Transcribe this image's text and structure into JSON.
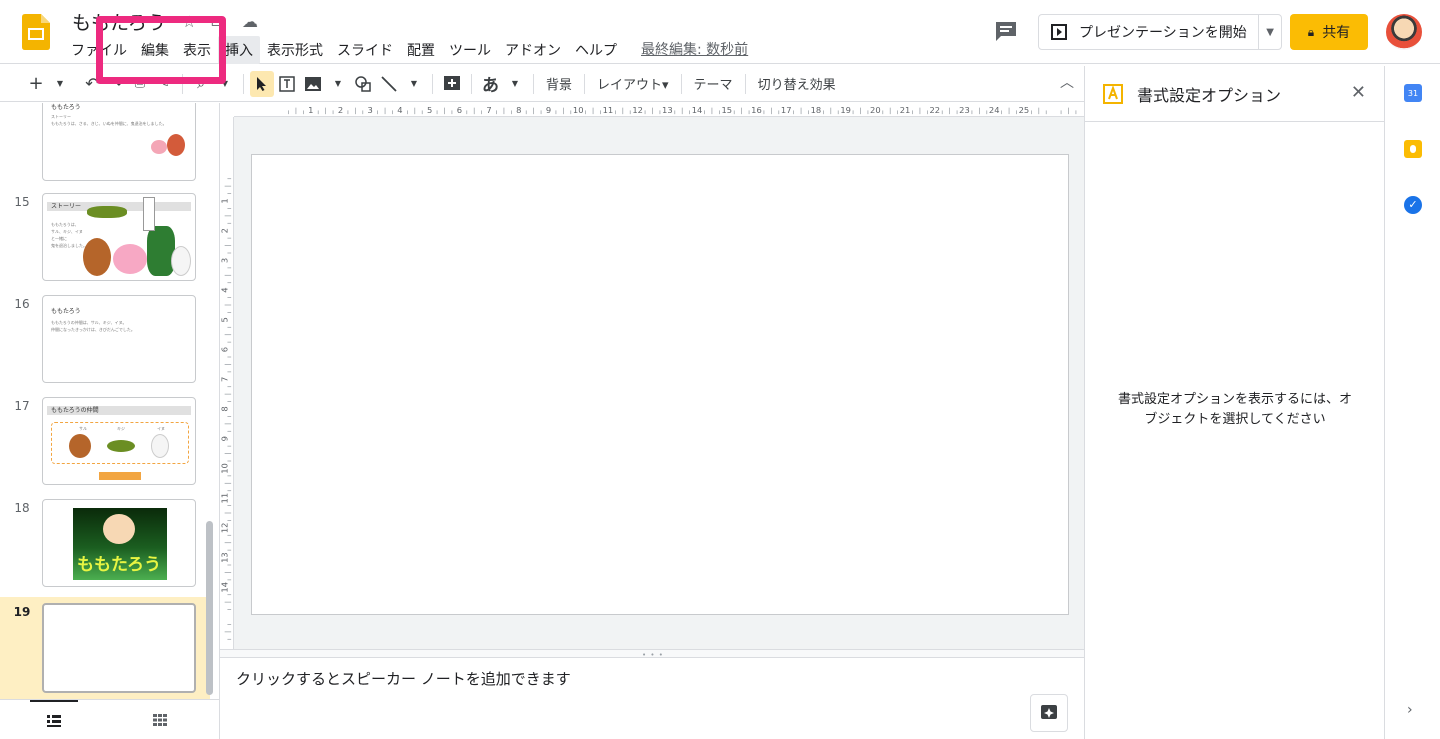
{
  "header": {
    "doc_title": "ももたろう",
    "menus": [
      "ファイル",
      "編集",
      "表示",
      "挿入",
      "表示形式",
      "スライド",
      "配置",
      "ツール",
      "アドオン",
      "ヘルプ"
    ],
    "last_edit": "最終編集: 数秒前",
    "present_label": "プレゼンテーションを開始",
    "share_label": "共有",
    "share_color": "#fbbc04"
  },
  "toolbar": {
    "background_label": "背景",
    "layout_label": "レイアウト▾",
    "theme_label": "テーマ",
    "transition_label": "切り替え効果",
    "font_glyph": "あ"
  },
  "filmstrip": {
    "slides": [
      {
        "num": "",
        "title": "ももたろう",
        "lines": [
          "ストーリー",
          "ももたろうは、さる、きじ、いぬを仲間に、鬼退治をしました。"
        ]
      },
      {
        "num": "15",
        "title": "ストーリー",
        "lines": [
          "ももたろうは、",
          "サル、キジ、イヌ",
          "と一緒に",
          "鬼を退治しました。"
        ]
      },
      {
        "num": "16",
        "title": "ももたろう",
        "lines": [
          "ももたろうの仲間は、サル、キジ、イヌ。",
          "仲間になったきっかけは、きびだんごでした。"
        ]
      },
      {
        "num": "17",
        "title": "ももたろうの仲間",
        "labels": [
          "サル",
          "キジ",
          "イヌ"
        ]
      },
      {
        "num": "18",
        "title": "ももたろう"
      },
      {
        "num": "19",
        "title": ""
      }
    ],
    "current_slide": "19"
  },
  "ruler": {
    "h_ticks": [
      "1",
      "2",
      "3",
      "4",
      "5",
      "6",
      "7",
      "8",
      "9",
      "10",
      "11",
      "12",
      "13",
      "14",
      "15",
      "16",
      "17",
      "18",
      "19",
      "20",
      "21",
      "22",
      "23",
      "24",
      "25"
    ],
    "v_ticks": [
      "1",
      "2",
      "3",
      "4",
      "5",
      "6",
      "7",
      "8",
      "9",
      "10",
      "11",
      "12",
      "13",
      "14"
    ]
  },
  "notes": {
    "placeholder": "クリックするとスピーカー ノートを追加できます"
  },
  "format_panel": {
    "title": "書式設定オプション",
    "message_line1": "書式設定オプションを表示するには、オ",
    "message_line2": "ブジェクトを選択してください"
  },
  "colors": {
    "highlight": "#ed2a7f",
    "selected_slide_bg": "#feefc3",
    "accent_yellow": "#fbbc04"
  }
}
